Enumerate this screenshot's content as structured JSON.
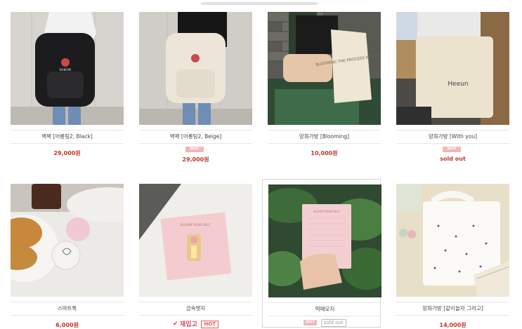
{
  "products": [
    {
      "name": "백팩 [어롱팀2, Black]",
      "price": "29,000원",
      "best": false,
      "soldout": false
    },
    {
      "name": "백팩 [어롱팀2, Beige]",
      "price": "29,000원",
      "best": true,
      "best_label": "BEST"
    },
    {
      "name": "앙화가방 [Blooming]",
      "price": "10,000원"
    },
    {
      "name": "앙화가방 [With you]",
      "price": "sold out",
      "best": true,
      "best_label": "BEST"
    },
    {
      "name": "스마트톡",
      "price": "6,000원"
    },
    {
      "name": "금속뱃지",
      "badge_new": "재입고",
      "badge_hot": "HOT",
      "check": "✔"
    },
    {
      "name": "떡메모지",
      "best_label": "BEST",
      "soldout_label": "sold out"
    },
    {
      "name": "앙화가방 [같이놀자 그리고]",
      "price": "14,000원"
    }
  ],
  "images": {
    "p1_text": "BOBOIM",
    "p3_tote_text": "BLOOMING THE PROCESS WITH YOU",
    "p4_tote_text": "Heeun",
    "p6_card_text": "BLOOM YOUR SELF",
    "p7_memo_text": "BLOOM YOUR SELF"
  },
  "colors": {
    "price": "#c0392b",
    "best": "#f0b8b8",
    "hot": "#e35b5b"
  }
}
